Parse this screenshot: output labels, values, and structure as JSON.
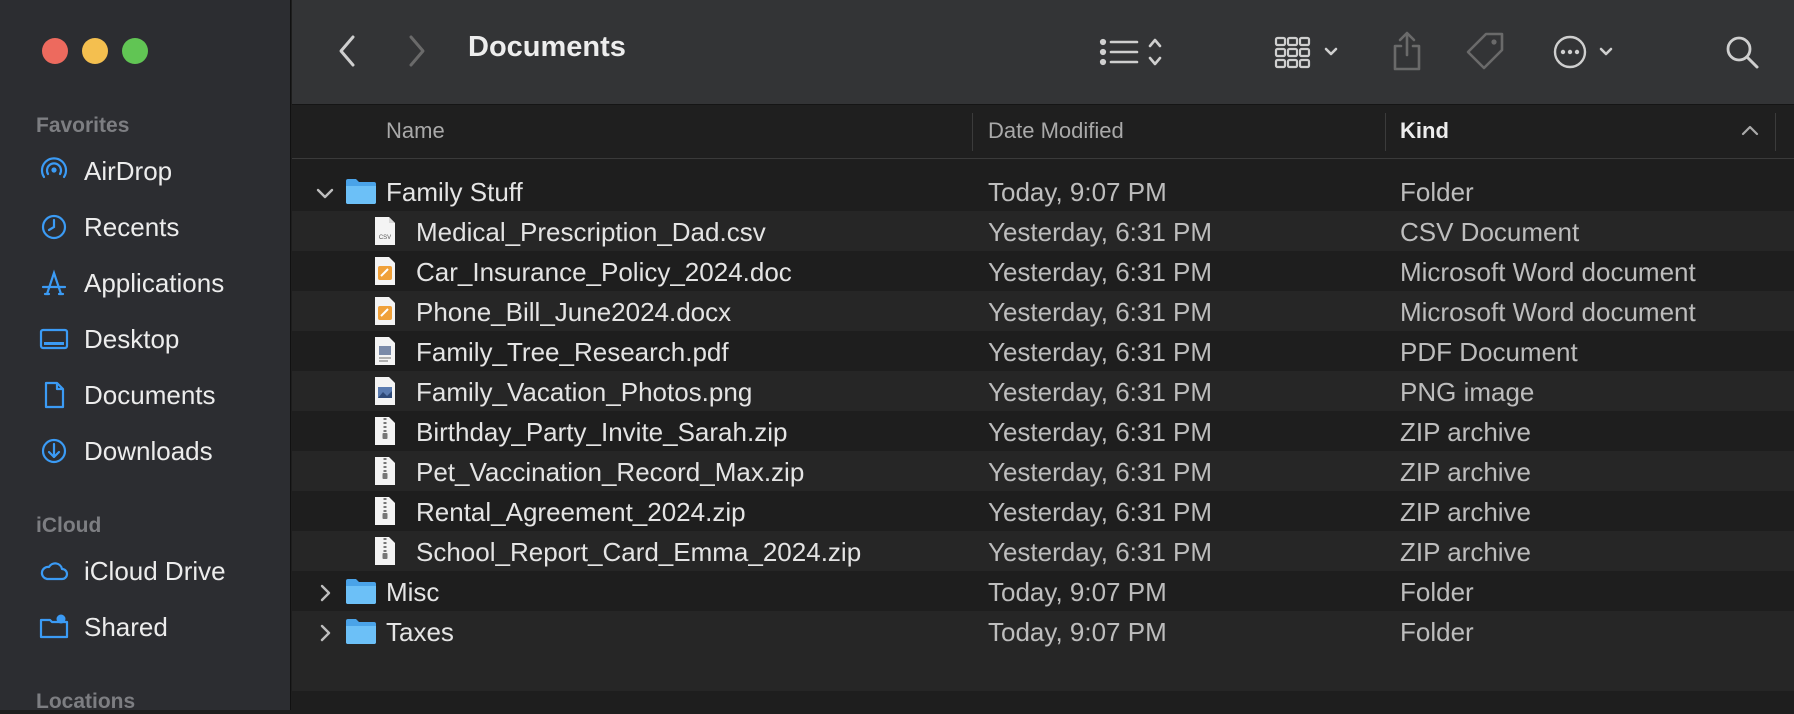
{
  "window": {
    "title": "Documents"
  },
  "sidebar": {
    "favorites_label": "Favorites",
    "favorites": [
      {
        "label": "AirDrop",
        "icon": "airdrop-icon"
      },
      {
        "label": "Recents",
        "icon": "clock-icon"
      },
      {
        "label": "Applications",
        "icon": "applications-icon"
      },
      {
        "label": "Desktop",
        "icon": "desktop-icon"
      },
      {
        "label": "Documents",
        "icon": "document-icon"
      },
      {
        "label": "Downloads",
        "icon": "download-icon"
      }
    ],
    "icloud_label": "iCloud",
    "icloud": [
      {
        "label": "iCloud Drive",
        "icon": "cloud-icon"
      },
      {
        "label": "Shared",
        "icon": "shared-folder-icon"
      }
    ],
    "locations_label": "Locations"
  },
  "columns": {
    "name": "Name",
    "date": "Date Modified",
    "kind": "Kind"
  },
  "rows": [
    {
      "name": "Family Stuff",
      "date": "Today, 9:07 PM",
      "kind": "Folder",
      "type": "folder",
      "expanded": true,
      "level": 0
    },
    {
      "name": "Medical_Prescription_Dad.csv",
      "date": "Yesterday, 6:31 PM",
      "kind": "CSV Document",
      "type": "csv",
      "level": 1
    },
    {
      "name": "Car_Insurance_Policy_2024.doc",
      "date": "Yesterday, 6:31 PM",
      "kind": "Microsoft Word document",
      "type": "word",
      "level": 1
    },
    {
      "name": "Phone_Bill_June2024.docx",
      "date": "Yesterday, 6:31 PM",
      "kind": "Microsoft Word document",
      "type": "word",
      "level": 1
    },
    {
      "name": "Family_Tree_Research.pdf",
      "date": "Yesterday, 6:31 PM",
      "kind": "PDF Document",
      "type": "pdf",
      "level": 1
    },
    {
      "name": "Family_Vacation_Photos.png",
      "date": "Yesterday, 6:31 PM",
      "kind": "PNG image",
      "type": "png",
      "level": 1
    },
    {
      "name": "Birthday_Party_Invite_Sarah.zip",
      "date": "Yesterday, 6:31 PM",
      "kind": "ZIP archive",
      "type": "zip",
      "level": 1
    },
    {
      "name": "Pet_Vaccination_Record_Max.zip",
      "date": "Yesterday, 6:31 PM",
      "kind": "ZIP archive",
      "type": "zip",
      "level": 1
    },
    {
      "name": "Rental_Agreement_2024.zip",
      "date": "Yesterday, 6:31 PM",
      "kind": "ZIP archive",
      "type": "zip",
      "level": 1
    },
    {
      "name": "School_Report_Card_Emma_2024.zip",
      "date": "Yesterday, 6:31 PM",
      "kind": "ZIP archive",
      "type": "zip",
      "level": 1
    },
    {
      "name": "Misc",
      "date": "Today, 9:07 PM",
      "kind": "Folder",
      "type": "folder",
      "expanded": false,
      "level": 0
    },
    {
      "name": "Taxes",
      "date": "Today, 9:07 PM",
      "kind": "Folder",
      "type": "folder",
      "expanded": false,
      "level": 0
    }
  ],
  "colors": {
    "accent": "#3a95f0",
    "folder": "#5bb4f4",
    "sidebar_icon": "#3b9bf5"
  }
}
